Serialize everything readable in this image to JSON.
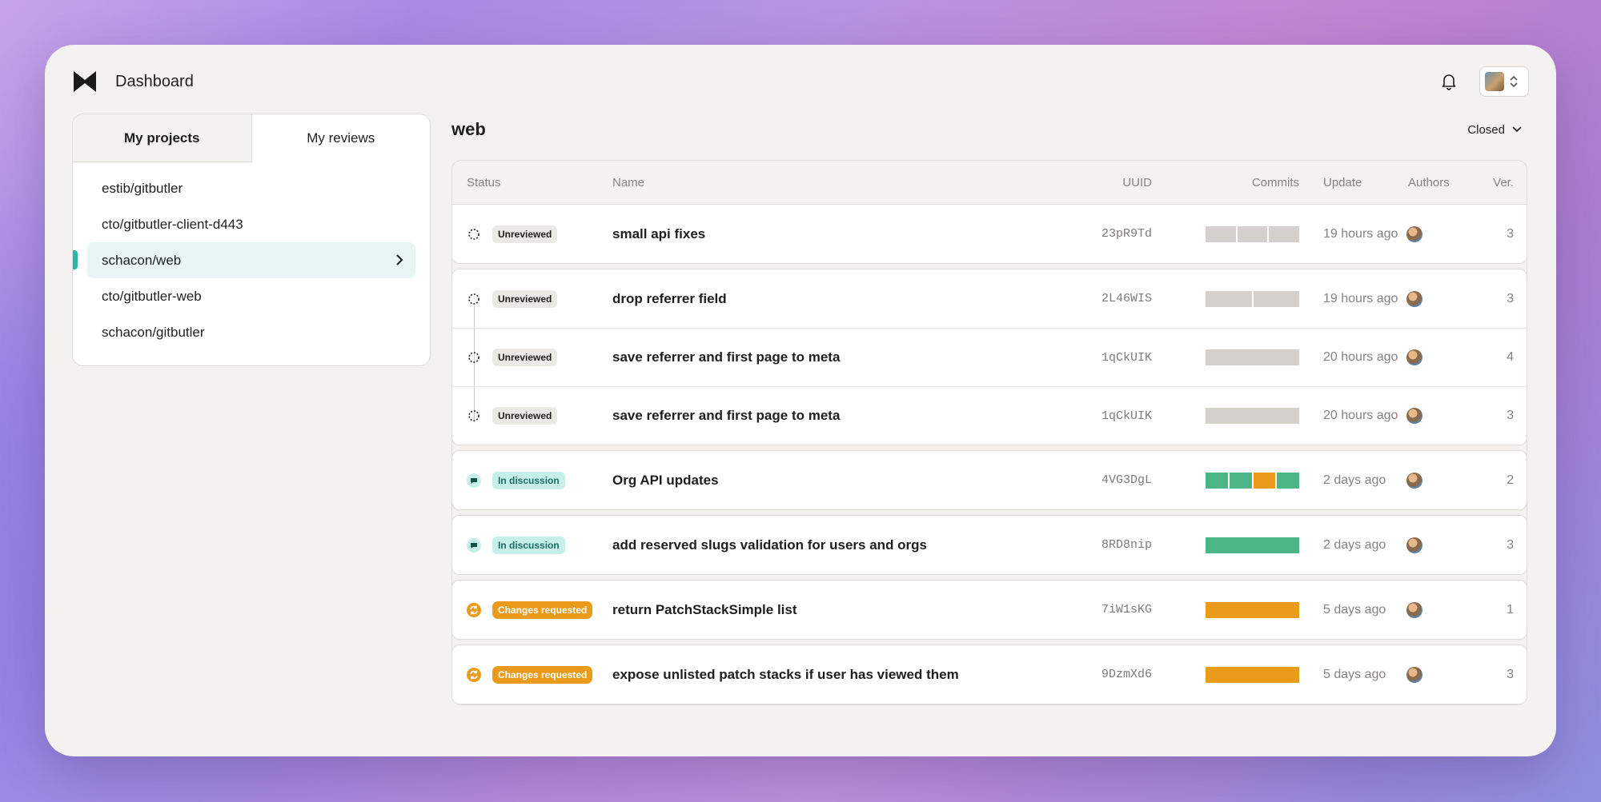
{
  "app": {
    "title": "Dashboard"
  },
  "sidebar": {
    "tabs": [
      {
        "label": "My projects"
      },
      {
        "label": "My reviews"
      }
    ],
    "repos": [
      {
        "label": "estib/gitbutler"
      },
      {
        "label": "cto/gitbutler-client-d443"
      },
      {
        "label": "schacon/web"
      },
      {
        "label": "cto/gitbutler-web"
      },
      {
        "label": "schacon/gitbutler"
      }
    ],
    "selected_repo": "schacon/web"
  },
  "main": {
    "title": "web",
    "filter": "Closed",
    "columns": {
      "status": "Status",
      "name": "Name",
      "uuid": "UUID",
      "commits": "Commits",
      "update": "Update",
      "authors": "Authors",
      "ver": "Ver."
    },
    "rows": [
      {
        "status": "Unreviewed",
        "name": "small api fixes",
        "uuid": "23pR9Td",
        "update": "19 hours ago",
        "ver": "3"
      },
      {
        "status": "Unreviewed",
        "name": "drop referrer field",
        "uuid": "2L46WIS",
        "update": "19 hours ago",
        "ver": "3"
      },
      {
        "status": "Unreviewed",
        "name": "save referrer and first page to meta",
        "uuid": "1qCkUIK",
        "update": "20 hours ago",
        "ver": "4"
      },
      {
        "status": "Unreviewed",
        "name": "save referrer and first page to meta",
        "uuid": "1qCkUIK",
        "update": "20 hours ago",
        "ver": "3"
      },
      {
        "status": "In discussion",
        "name": "Org API updates",
        "uuid": "4VG3DgL",
        "update": "2 days ago",
        "ver": "2"
      },
      {
        "status": "In discussion",
        "name": "add reserved slugs validation for users and orgs",
        "uuid": "8RD8nip",
        "update": "2 days ago",
        "ver": "3"
      },
      {
        "status": "Changes requested",
        "name": "return PatchStackSimple list",
        "uuid": "7iW1sKG",
        "update": "5 days ago",
        "ver": "1"
      },
      {
        "status": "Changes requested",
        "name": "expose unlisted patch stacks if user has viewed them",
        "uuid": "9DzmXd6",
        "update": "5 days ago",
        "ver": "3"
      }
    ]
  },
  "colors": {
    "accent": "#2fb5ab",
    "commit_grey": "#d4d1cd",
    "commit_green": "#4cb585",
    "commit_orange": "#eb9b1b"
  }
}
